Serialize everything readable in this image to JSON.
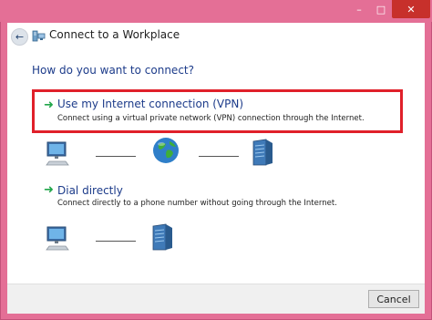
{
  "window": {
    "title": "Connect to a Workplace",
    "controls": {
      "minimize": "–",
      "maximize": "□",
      "close": "✕"
    }
  },
  "back_glyph": "←",
  "question": "How do you want to connect?",
  "options": [
    {
      "title": "Use my Internet connection (VPN)",
      "description": "Connect using a virtual private network (VPN) connection through the Internet.",
      "selected": true
    },
    {
      "title": "Dial directly",
      "description": "Connect directly to a phone number without going through the Internet.",
      "selected": false
    }
  ],
  "arrow_glyph": "➜",
  "footer": {
    "cancel_label": "Cancel"
  },
  "colors": {
    "accent_border": "#e46f96",
    "link_text": "#1c3b8a",
    "selection_border": "#e0202a",
    "arrow": "#21a64a"
  },
  "icons": [
    "back-arrow-icon",
    "network-app-icon",
    "computer-icon",
    "globe-icon",
    "server-icon",
    "green-arrow-icon"
  ]
}
